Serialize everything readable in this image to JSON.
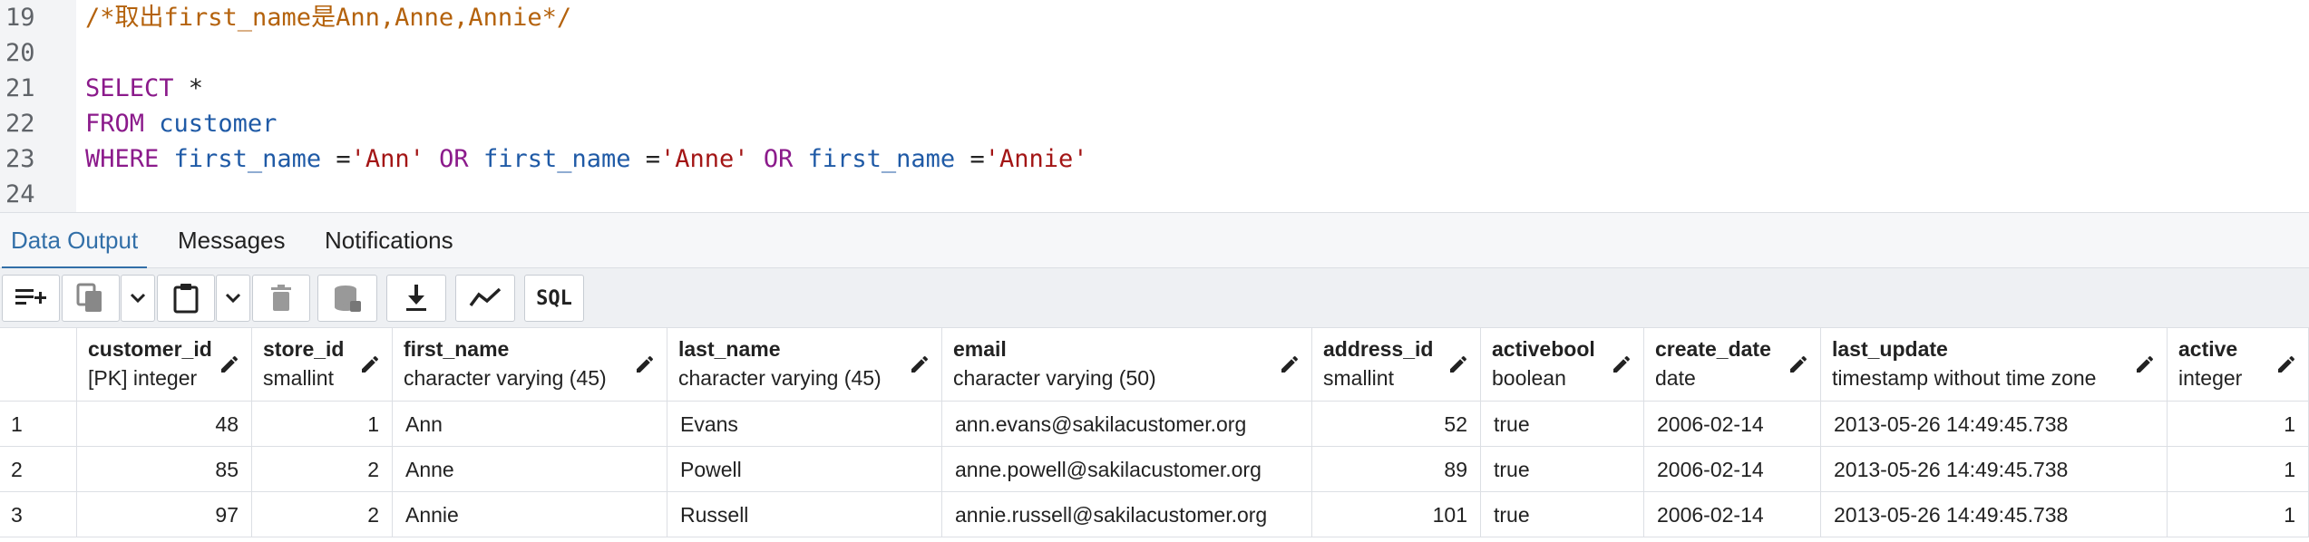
{
  "editor": {
    "lines": [
      {
        "num": "19",
        "tokens": [
          {
            "t": "/*取出first_name是Ann,Anne,Annie*/",
            "c": "comment"
          }
        ]
      },
      {
        "num": "20",
        "tokens": []
      },
      {
        "num": "21",
        "tokens": [
          {
            "t": "SELECT",
            "c": "kw"
          },
          {
            "t": " *",
            "c": "plain"
          }
        ]
      },
      {
        "num": "22",
        "tokens": [
          {
            "t": "FROM",
            "c": "kw"
          },
          {
            "t": " ",
            "c": "plain"
          },
          {
            "t": "customer",
            "c": "id"
          }
        ]
      },
      {
        "num": "23",
        "tokens": [
          {
            "t": "WHERE",
            "c": "kw"
          },
          {
            "t": " ",
            "c": "plain"
          },
          {
            "t": "first_name",
            "c": "id"
          },
          {
            "t": " =",
            "c": "plain"
          },
          {
            "t": "'Ann'",
            "c": "str"
          },
          {
            "t": " ",
            "c": "plain"
          },
          {
            "t": "OR",
            "c": "kw"
          },
          {
            "t": " ",
            "c": "plain"
          },
          {
            "t": "first_name",
            "c": "id"
          },
          {
            "t": " =",
            "c": "plain"
          },
          {
            "t": "'Anne'",
            "c": "str"
          },
          {
            "t": " ",
            "c": "plain"
          },
          {
            "t": "OR",
            "c": "kw"
          },
          {
            "t": " ",
            "c": "plain"
          },
          {
            "t": "first_name",
            "c": "id"
          },
          {
            "t": " =",
            "c": "plain"
          },
          {
            "t": "'Annie'",
            "c": "str"
          }
        ]
      },
      {
        "num": "24",
        "tokens": []
      }
    ]
  },
  "tabs": [
    {
      "label": "Data Output",
      "active": true
    },
    {
      "label": "Messages",
      "active": false
    },
    {
      "label": "Notifications",
      "active": false
    }
  ],
  "toolbar": {
    "sql_label": "SQL",
    "buttons": [
      "add-row-icon",
      "copy-icon",
      "chevron-down-icon",
      "paste-icon",
      "chevron-down-icon",
      "trash-icon",
      "save-data-icon",
      "download-icon",
      "graph-icon",
      "sql-icon"
    ]
  },
  "grid": {
    "columns": [
      {
        "name": "customer_id",
        "type": "[PK] integer",
        "align": "right"
      },
      {
        "name": "store_id",
        "type": "smallint",
        "align": "right"
      },
      {
        "name": "first_name",
        "type": "character varying (45)",
        "align": "left"
      },
      {
        "name": "last_name",
        "type": "character varying (45)",
        "align": "left"
      },
      {
        "name": "email",
        "type": "character varying (50)",
        "align": "left"
      },
      {
        "name": "address_id",
        "type": "smallint",
        "align": "right"
      },
      {
        "name": "activebool",
        "type": "boolean",
        "align": "left"
      },
      {
        "name": "create_date",
        "type": "date",
        "align": "left"
      },
      {
        "name": "last_update",
        "type": "timestamp without time zone",
        "align": "left"
      },
      {
        "name": "active",
        "type": "integer",
        "align": "right"
      }
    ],
    "rows": [
      {
        "num": "1",
        "cells": [
          "48",
          "1",
          "Ann",
          "Evans",
          "ann.evans@sakilacustomer.org",
          "52",
          "true",
          "2006-02-14",
          "2013-05-26 14:49:45.738",
          "1"
        ]
      },
      {
        "num": "2",
        "cells": [
          "85",
          "2",
          "Anne",
          "Powell",
          "anne.powell@sakilacustomer.org",
          "89",
          "true",
          "2006-02-14",
          "2013-05-26 14:49:45.738",
          "1"
        ]
      },
      {
        "num": "3",
        "cells": [
          "97",
          "2",
          "Annie",
          "Russell",
          "annie.russell@sakilacustomer.org",
          "101",
          "true",
          "2006-02-14",
          "2013-05-26 14:49:45.738",
          "1"
        ]
      }
    ]
  },
  "colors": {
    "accent": "#326fa8",
    "keyword": "#8b1a8b",
    "identifier": "#1f5aa6",
    "string": "#a31515",
    "comment": "#b4620c"
  }
}
